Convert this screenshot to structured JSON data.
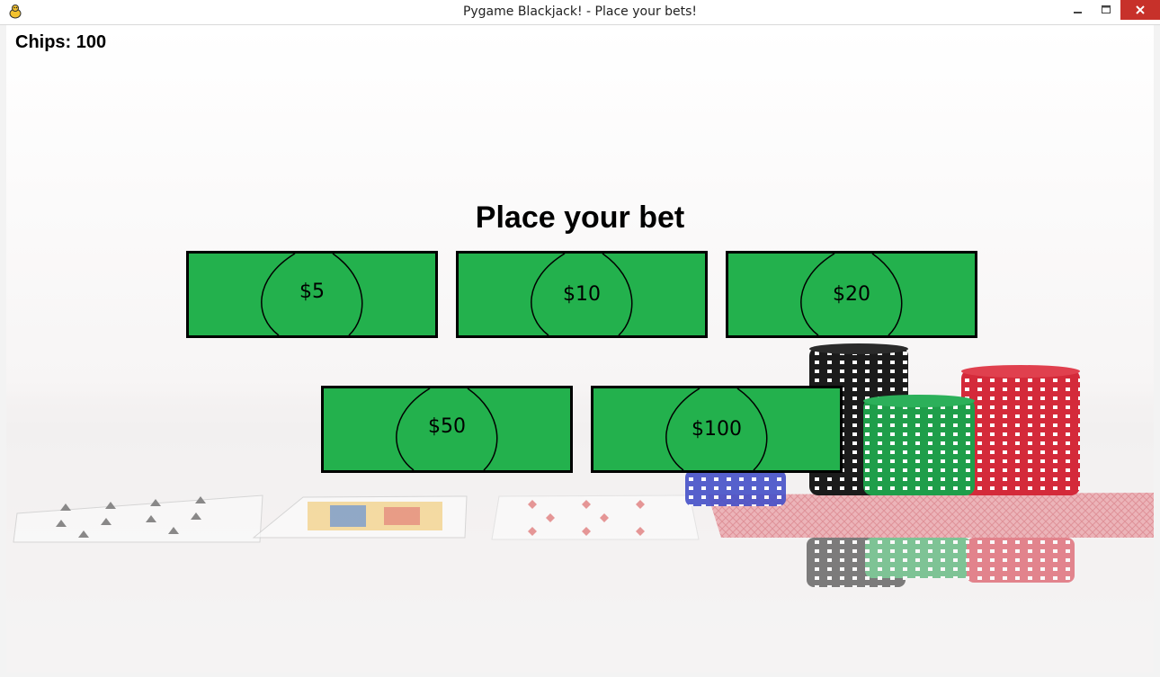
{
  "window": {
    "title": "Pygame Blackjack! - Place your bets!"
  },
  "hud": {
    "chips_text": "Chips: 100"
  },
  "prompt": {
    "heading": "Place your bet"
  },
  "bets": [
    {
      "label": "$5",
      "value": 5
    },
    {
      "label": "$10",
      "value": 10
    },
    {
      "label": "$20",
      "value": 20
    },
    {
      "label": "$50",
      "value": 50
    },
    {
      "label": "$100",
      "value": 100
    }
  ],
  "colors": {
    "bill_green": "#23b14d",
    "bill_border": "#000000",
    "close_button": "#c7312a"
  },
  "icons": {
    "app": "pygame-snake-icon",
    "minimize": "minimize-icon",
    "maximize": "maximize-icon",
    "close": "close-icon"
  }
}
